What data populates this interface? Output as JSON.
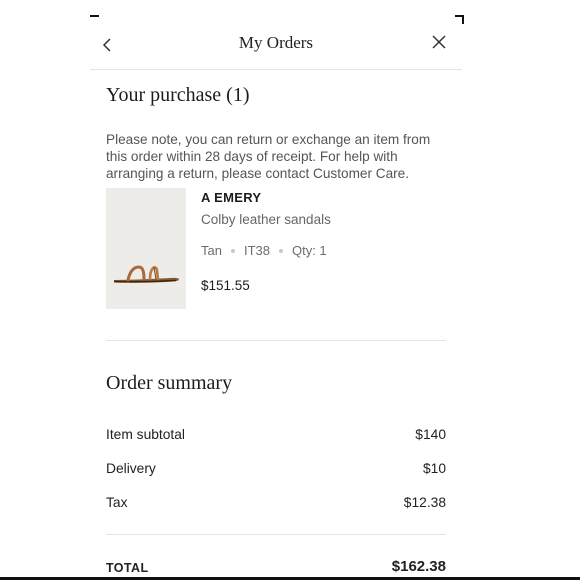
{
  "header": {
    "title": "My Orders",
    "back_icon": "chevron-left-icon",
    "close_icon": "close-icon"
  },
  "purchase": {
    "heading": "Your purchase (1)",
    "note": "Please note, you can return or exchange an item from this order within 28 days of receipt. For help with arranging a return, please contact Customer Care.",
    "items": [
      {
        "brand": "A EMERY",
        "name": "Colby leather sandals",
        "color": "Tan",
        "size": "IT38",
        "quantity": "Qty: 1",
        "price": "$151.55"
      }
    ]
  },
  "summary": {
    "heading": "Order summary",
    "rows": [
      {
        "label": "Item subtotal",
        "value": "$140"
      },
      {
        "label": "Delivery",
        "value": "$10"
      },
      {
        "label": "Tax",
        "value": "$12.38"
      }
    ],
    "total": {
      "label": "TOTAL",
      "value": "$162.38"
    }
  },
  "colors": {
    "text_primary": "#222222",
    "text_secondary": "#666666",
    "divider": "#e4e4e4",
    "product_leather": "#a86a3a",
    "thumbnail_bg": "#eeece9"
  }
}
